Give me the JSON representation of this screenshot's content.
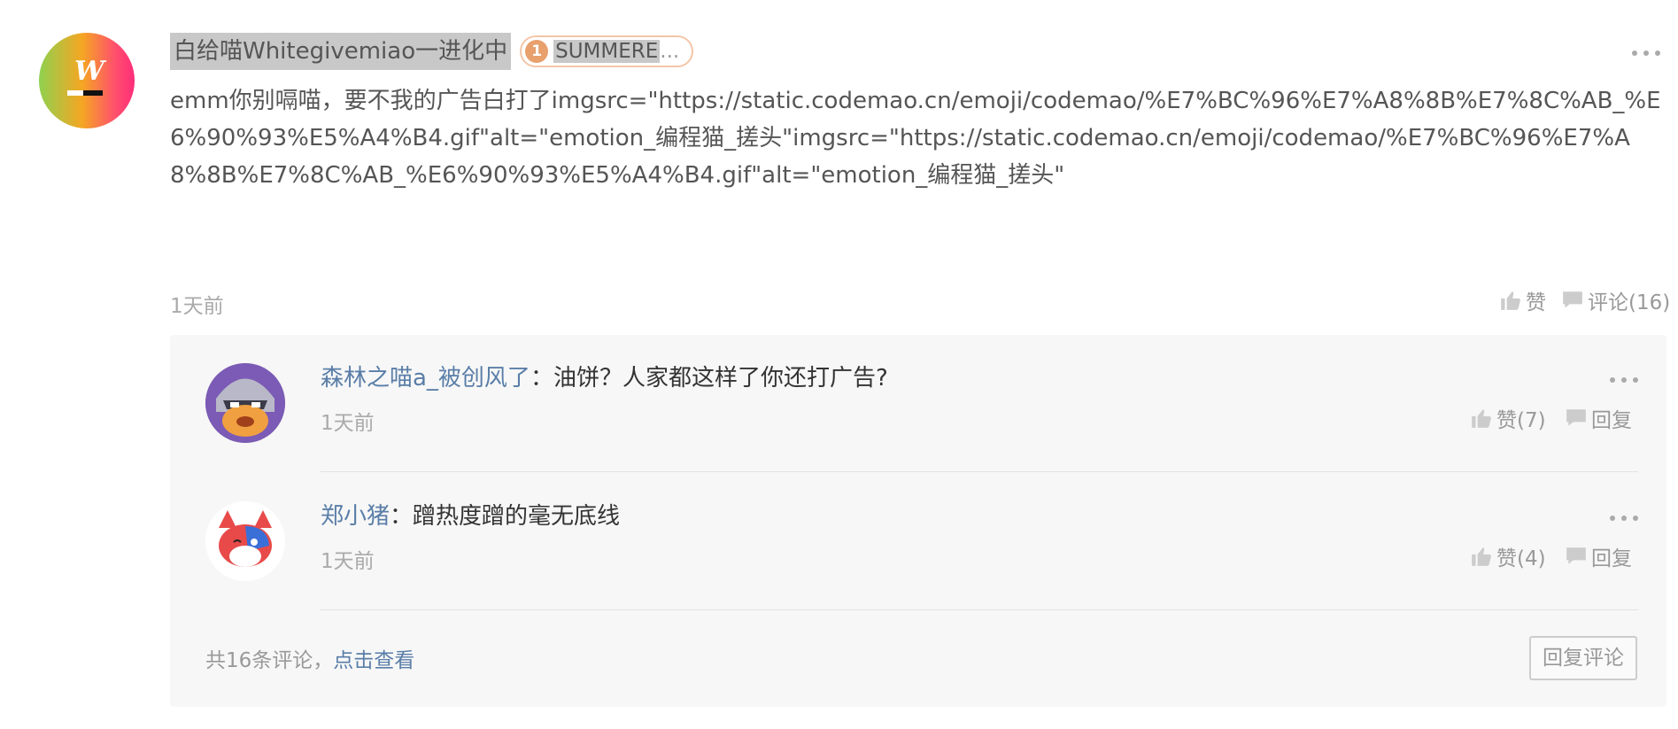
{
  "post": {
    "username": "白给喵Whitegivemiao一进化中",
    "badge_number": "1",
    "badge_text": "SUMMERE",
    "badge_ellipsis": "...",
    "text": "emm你别嗝喵，要不我的广告白打了imgsrc=\"https://static.codemao.cn/emoji/codemao/%E7%BC%96%E7%A8%8B%E7%8C%AB_%E6%90%93%E5%A4%B4.gif\"alt=\"emotion_编程猫_搓头\"imgsrc=\"https://static.codemao.cn/emoji/codemao/%E7%BC%96%E7%A8%8B%E7%8C%AB_%E6%90%93%E5%A4%B4.gif\"alt=\"emotion_编程猫_搓头\"",
    "time": "1天前",
    "like_label": "赞",
    "comment_label": "评论(16)"
  },
  "replies": [
    {
      "user": "森林之喵a_被创风了",
      "separator": "：",
      "text": "油饼？人家都这样了你还打广告?",
      "time": "1天前",
      "like_label": "赞(7)",
      "reply_label": "回复"
    },
    {
      "user": "郑小猪",
      "separator": "：",
      "text": "蹭热度蹭的毫无底线",
      "time": "1天前",
      "like_label": "赞(4)",
      "reply_label": "回复"
    }
  ],
  "footer": {
    "count_text": "共16条评论，",
    "link_text": "点击查看",
    "reply_button": "回复评论"
  },
  "icons": {
    "more": "more-dots-icon",
    "like": "thumbs-up-icon",
    "comment": "comment-bubble-icon"
  },
  "colors": {
    "link": "#5a7ea8",
    "badge_border": "#f4c6a8",
    "badge_fill": "#e8a06c"
  }
}
